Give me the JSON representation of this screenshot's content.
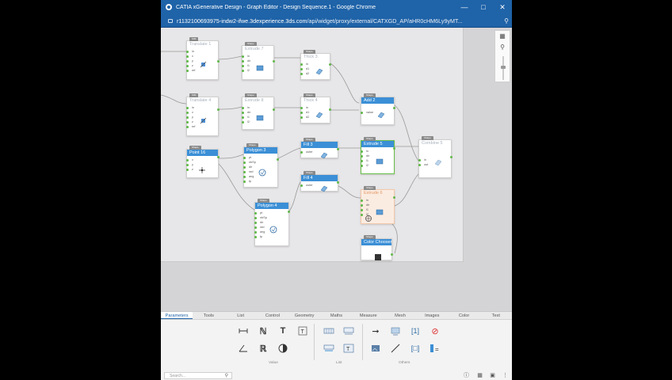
{
  "window": {
    "title": "CATIA xGenerative Design - Graph Editor - Design Sequence.1 - Google Chrome",
    "url_host": "r1132100693975-indw2-ifwe.3dexperience.3ds.com",
    "url_path": "/api/widget/proxy/external/CATXGD_AP/aHR0cHM6Ly9yMT..."
  },
  "graph": {
    "nodes": [
      {
        "id": "translate1",
        "title": "Translate 1",
        "ports": [
          "in",
          "x",
          "y",
          "z",
          "ref"
        ],
        "state": "ghost"
      },
      {
        "id": "extrude7",
        "title": "Extrude 7",
        "ports": [
          "in",
          "dir",
          "l1",
          "l2"
        ],
        "state": "ghost"
      },
      {
        "id": "thick3",
        "title": "Thick 3",
        "ports": [
          "in",
          "d1",
          "d2"
        ],
        "state": "ghost"
      },
      {
        "id": "translate4",
        "title": "Translate 4",
        "ports": [
          "in",
          "x",
          "y",
          "z",
          "ref"
        ],
        "state": "ghost"
      },
      {
        "id": "extrude8",
        "title": "Extrude 8",
        "ports": [
          "in",
          "dir",
          "l1",
          "l2"
        ],
        "state": "ghost"
      },
      {
        "id": "thick4",
        "title": "Thick 4",
        "ports": [
          "in",
          "d1",
          "d2"
        ],
        "state": "ghost"
      },
      {
        "id": "add2",
        "title": "Add 2",
        "ports": [
          "value"
        ],
        "state": "active"
      },
      {
        "id": "point16",
        "title": "Point 16",
        "ports": [
          "x",
          "y",
          "z"
        ],
        "state": "active"
      },
      {
        "id": "polygon3",
        "title": "Polygon 3",
        "ports": [
          "pt",
          "nbSp",
          "dir",
          "rad",
          "ang",
          "tp"
        ],
        "state": "active"
      },
      {
        "id": "fill3",
        "title": "Fill 3",
        "ports": [
          "outer"
        ],
        "state": "active"
      },
      {
        "id": "extrude5",
        "title": "Extrude 5",
        "ports": [
          "in",
          "dir",
          "l1",
          "l2"
        ],
        "state": "sel"
      },
      {
        "id": "combine5",
        "title": "Combine 5",
        "ports": [
          "in",
          "out"
        ],
        "state": "ghost"
      },
      {
        "id": "fill4",
        "title": "Fill 4",
        "ports": [
          "outer"
        ],
        "state": "active"
      },
      {
        "id": "polygon4",
        "title": "Polygon 4",
        "ports": [
          "pt",
          "nbSp",
          "dir",
          "rad",
          "ang",
          "tp"
        ],
        "state": "active"
      },
      {
        "id": "extrude6",
        "title": "Extrude 6",
        "ports": [
          "in",
          "dir",
          "l1",
          "l2"
        ],
        "state": "err"
      },
      {
        "id": "colorchooser",
        "title": "Color Chooser",
        "ports": [],
        "state": "active"
      }
    ],
    "wire_labels": [
      "Item",
      "Item",
      "Item",
      "Item",
      "Item",
      "Item",
      "Item",
      "Item",
      "Item"
    ]
  },
  "mini_palette": {
    "items": [
      "map-icon",
      "zoom-icon"
    ]
  },
  "panel": {
    "tabs": [
      "Parameters",
      "Tools",
      "List",
      "Control",
      "Geometry",
      "Maths",
      "Measure",
      "Mesh",
      "Images",
      "Color",
      "Text"
    ],
    "active_tab": "Parameters",
    "groups": [
      "Value",
      "List",
      "Others"
    ],
    "search_placeholder": "Search..."
  }
}
